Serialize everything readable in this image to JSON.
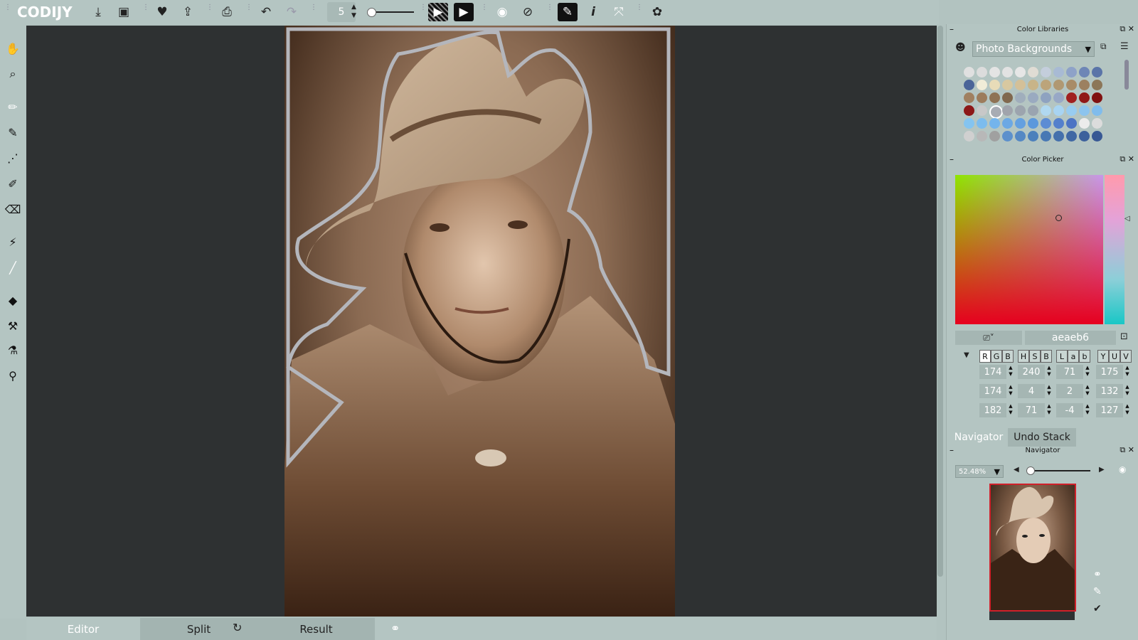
{
  "app": {
    "logo": "CODIJY"
  },
  "toolbar": {
    "brush_size": "5"
  },
  "canvas_tabs": {
    "editor": "Editor",
    "split": "Split",
    "result": "Result"
  },
  "color_libraries": {
    "title": "Color Libraries",
    "library": "Photo Backgrounds",
    "swatches": [
      [
        "#e0e0e0",
        "#dcdcdc",
        "#e4e4e4",
        "#e2e2e2",
        "#e6e6e6",
        "#e0dcd4",
        "#c4cedc",
        "#a8bad4",
        "#8ea2c8",
        "#6e86b6",
        "#5a74a8"
      ],
      [
        "#4a6498",
        "#f0ecd8",
        "#e8dcb8",
        "#d8c8a0",
        "#d4c098",
        "#c8b488",
        "#bca47a",
        "#b09872",
        "#a88c68",
        "#9c8060",
        "#8c7658"
      ],
      [
        "#a08060",
        "#9c7c5c",
        "#8e7254",
        "#80684e",
        "#a0aebc",
        "#9aaac0",
        "#8ea2c0",
        "#98a8c6",
        "#a02020",
        "#901818",
        "#801010"
      ],
      [
        "#8c1818",
        "#c8c8c8",
        "#a8acb4",
        "#a0a4ac",
        "#9ca4ae",
        "#9aa4b0",
        "#b0d8f0",
        "#a8d4f2",
        "#98ccf0",
        "#8cc4ee",
        "#80bcec"
      ],
      [
        "#84c4f0",
        "#7cbcee",
        "#74b4ec",
        "#6ca8e4",
        "#64a0e0",
        "#5c98dc",
        "#5c8cd4",
        "#5480cc",
        "#4c74c4",
        "#ececec",
        "#dcdcdc"
      ],
      [
        "#d0d0d0",
        "#b8b8b8",
        "#a0a0a0",
        "#5c90cc",
        "#5488c4",
        "#4c80bc",
        "#4878b4",
        "#4470ac",
        "#4068a4",
        "#3c609c",
        "#385894"
      ]
    ]
  },
  "color_picker": {
    "title": "Color Picker",
    "hex": "aeaeb6",
    "modes": {
      "rgb": [
        "R",
        "G",
        "B"
      ],
      "hsb": [
        "H",
        "S",
        "B"
      ],
      "lab": [
        "L",
        "a",
        "b"
      ],
      "yuv": [
        "Y",
        "U",
        "V"
      ]
    },
    "rows": [
      [
        "174",
        "240",
        "71",
        "175"
      ],
      [
        "174",
        "4",
        "2",
        "132"
      ],
      [
        "182",
        "71",
        "-4",
        "127"
      ]
    ]
  },
  "navigator": {
    "tabs": {
      "navigator": "Navigator",
      "undo": "Undo Stack"
    },
    "title": "Navigator",
    "zoom": "52.48%",
    "zoom_level": 0.05
  }
}
